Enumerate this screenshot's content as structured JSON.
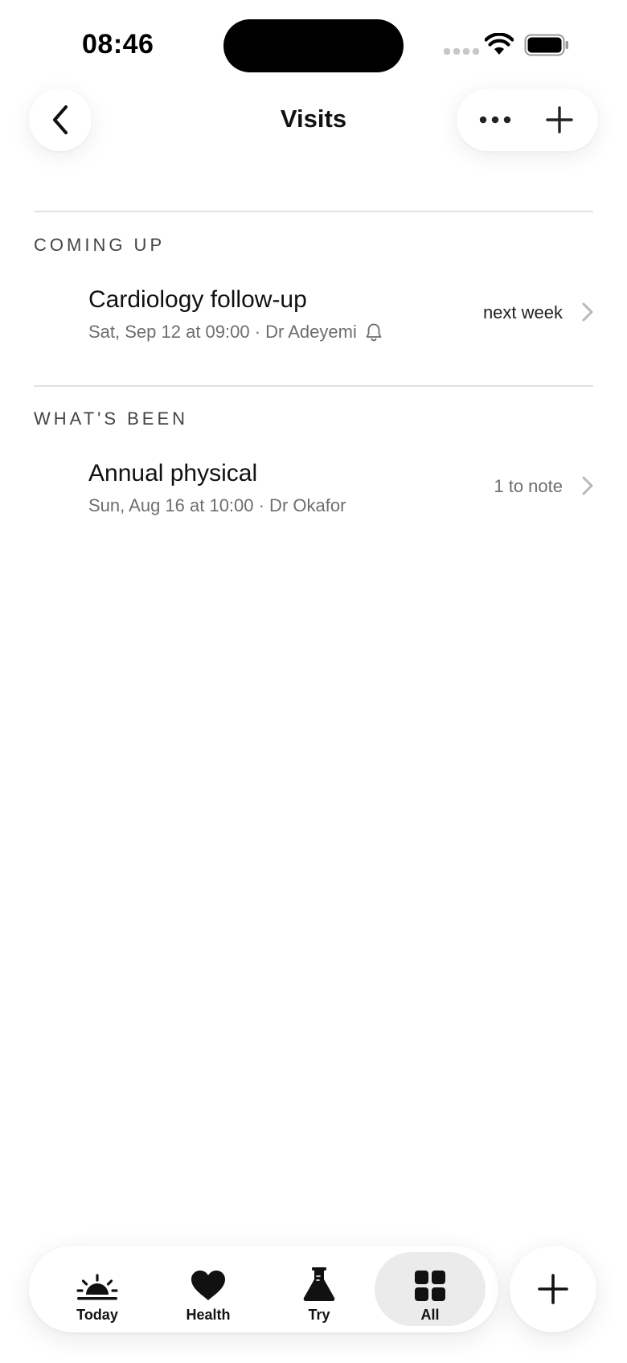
{
  "status_bar": {
    "time": "08:46"
  },
  "nav": {
    "title": "Visits"
  },
  "sections": [
    {
      "header": "COMING UP",
      "visits": [
        {
          "title": "Cardiology follow-up",
          "subtitle": "Sat, Sep 12 at 09:00 · Dr Adeyemi",
          "reminder_icon": "bell-icon",
          "right_label": "next week"
        }
      ]
    },
    {
      "header": "WHAT'S BEEN",
      "visits": [
        {
          "title": "Annual physical",
          "subtitle": "Sun, Aug 16 at 10:00 · Dr Okafor",
          "right_label": "1 to note"
        }
      ]
    }
  ],
  "tabbar": {
    "tabs": [
      {
        "label": "Today",
        "icon": "sunrise-icon"
      },
      {
        "label": "Health",
        "icon": "heart-icon"
      },
      {
        "label": "Try",
        "icon": "flask-icon"
      },
      {
        "label": "All",
        "icon": "grid-icon",
        "active": true
      }
    ]
  },
  "colors": {
    "text": "#111111",
    "secondary_text": "#6e6e6e",
    "divider": "#e2e2e2",
    "active_tab_bg": "#ebebeb"
  }
}
